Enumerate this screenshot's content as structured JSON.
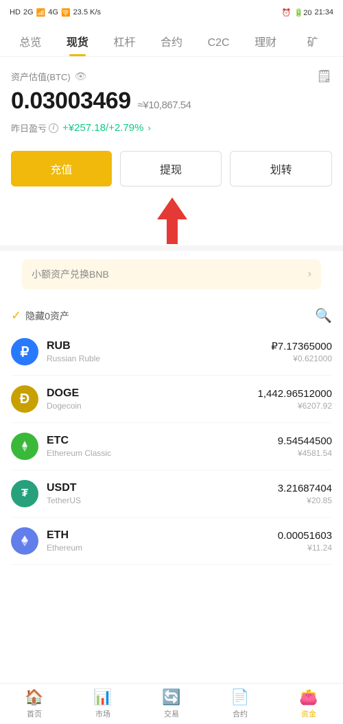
{
  "statusBar": {
    "left": "HD 2G 26 4G",
    "signal": "wifi",
    "speed": "23.5 K/s",
    "time": "21:34",
    "battery": "20"
  },
  "topNav": {
    "items": [
      {
        "label": "总览",
        "active": false
      },
      {
        "label": "现货",
        "active": true
      },
      {
        "label": "杠杆",
        "active": false
      },
      {
        "label": "合约",
        "active": false
      },
      {
        "label": "C2C",
        "active": false
      },
      {
        "label": "理财",
        "active": false
      },
      {
        "label": "矿",
        "active": false
      }
    ]
  },
  "asset": {
    "label": "资产估值(BTC)",
    "btcValue": "0.03003469",
    "cnyApprox": "≈¥10,867.54",
    "profitLabel": "昨日盈亏",
    "profitValue": "+¥257.18/+2.79%"
  },
  "actions": {
    "charge": "充值",
    "withdraw": "提现",
    "transfer": "划转"
  },
  "bnbBanner": {
    "text": "小额资产兑换BNB"
  },
  "hideRow": {
    "label": "隐藏0资产"
  },
  "coins": [
    {
      "symbol": "RUB",
      "name": "Russian Ruble",
      "amount": "₽7.17365000",
      "cny": "¥0.621000",
      "iconClass": "coin-rub",
      "iconText": "₽"
    },
    {
      "symbol": "DOGE",
      "name": "Dogecoin",
      "amount": "1,442.96512000",
      "cny": "¥6207.92",
      "iconClass": "coin-doge",
      "iconText": "Ð"
    },
    {
      "symbol": "ETC",
      "name": "Ethereum Classic",
      "amount": "9.54544500",
      "cny": "¥4581.54",
      "iconClass": "coin-etc",
      "iconText": "◆"
    },
    {
      "symbol": "USDT",
      "name": "TetherUS",
      "amount": "3.21687404",
      "cny": "¥20.85",
      "iconClass": "coin-usdt",
      "iconText": "₮"
    },
    {
      "symbol": "ETH",
      "name": "Ethereum",
      "amount": "0.00051603",
      "cny": "¥11.24",
      "iconClass": "coin-eth",
      "iconText": "Ξ"
    }
  ],
  "bottomNav": {
    "items": [
      {
        "label": "首页",
        "icon": "🏠",
        "active": false
      },
      {
        "label": "市场",
        "icon": "📊",
        "active": false
      },
      {
        "label": "交易",
        "icon": "🔄",
        "active": false
      },
      {
        "label": "合约",
        "icon": "📄",
        "active": false
      },
      {
        "label": "资金",
        "icon": "👛",
        "active": true
      }
    ]
  }
}
